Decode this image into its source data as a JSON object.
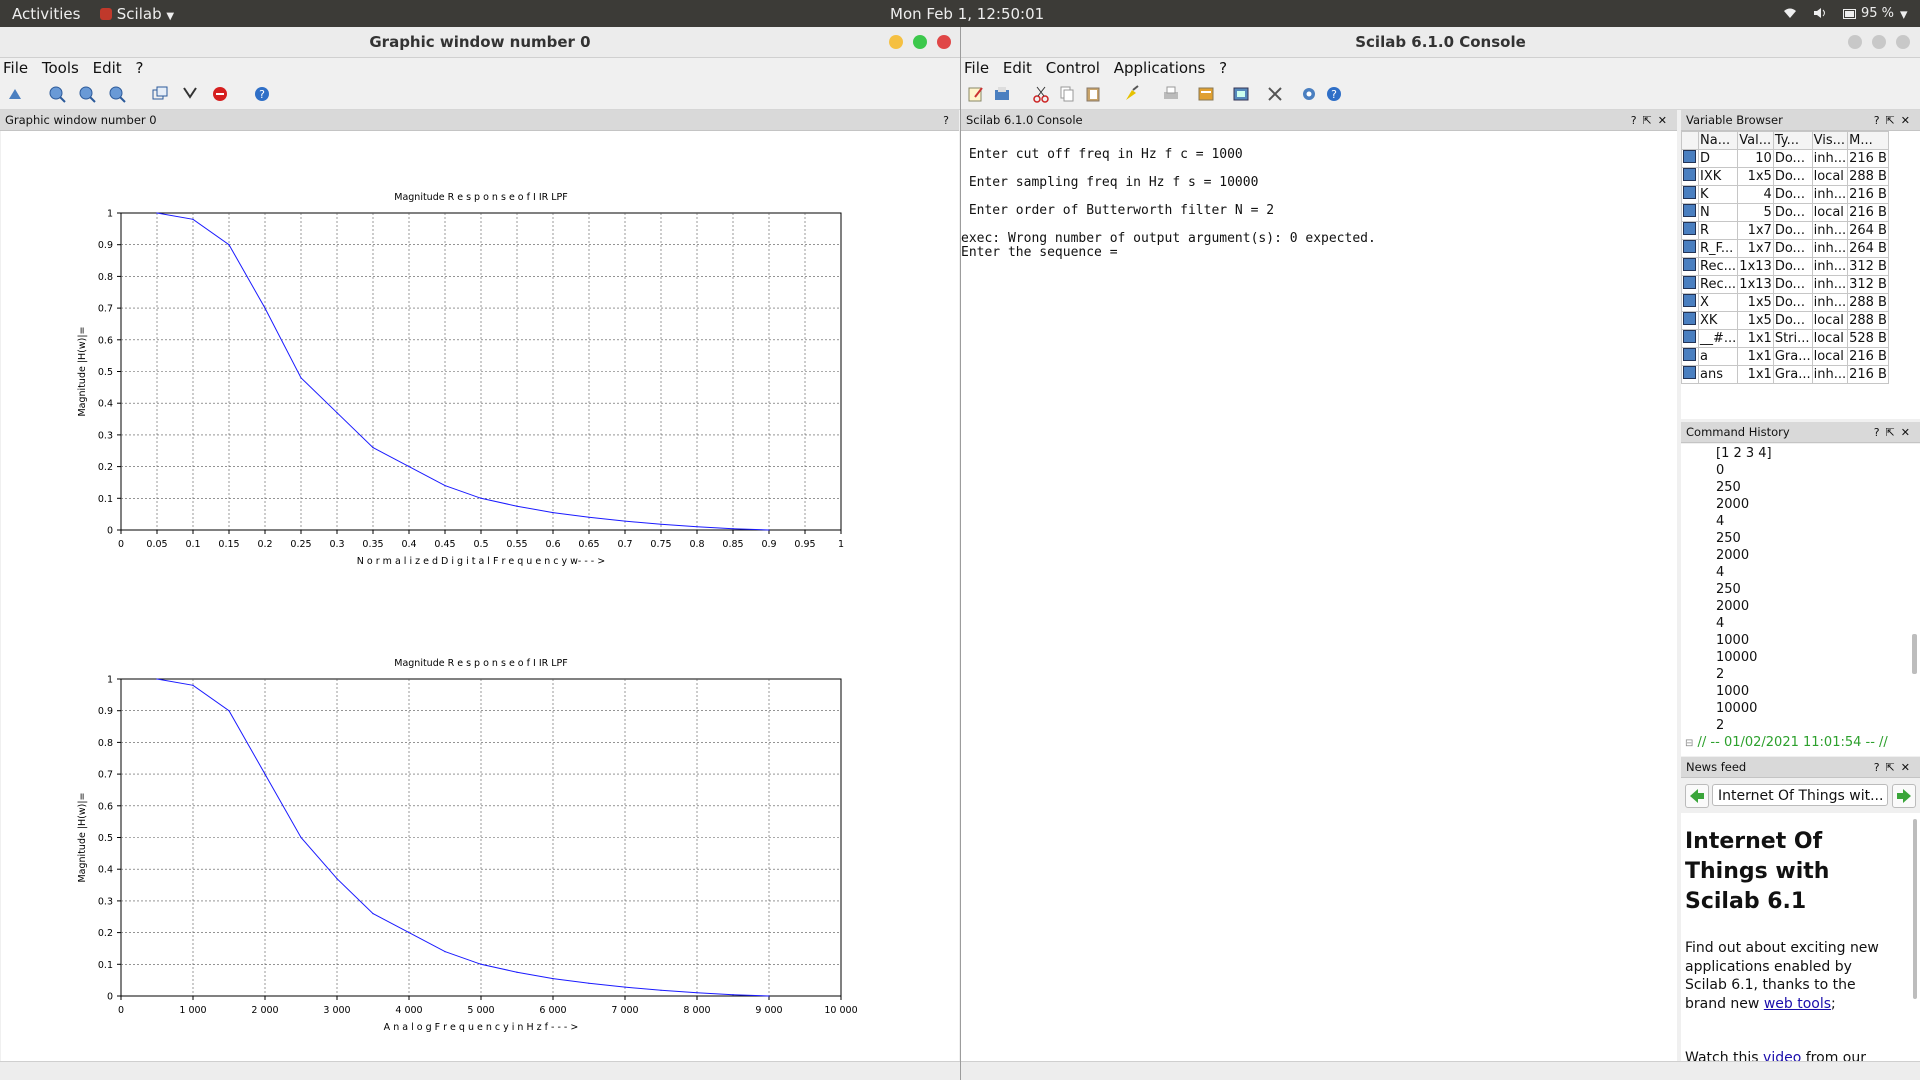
{
  "topbar": {
    "activities": "Activities",
    "app": "Scilab",
    "clock": "Mon Feb  1, 12:50:01",
    "battery": "95 %"
  },
  "graphic_window": {
    "title": "Graphic window number 0",
    "menu": [
      "File",
      "Tools",
      "Edit",
      "?"
    ],
    "dock_title": "Graphic window number 0"
  },
  "console_window": {
    "title": "Scilab 6.1.0 Console",
    "menu": [
      "File",
      "Edit",
      "Control",
      "Applications",
      "?"
    ],
    "dock_title": "Scilab 6.1.0 Console",
    "lines": [
      " Enter cut off freq in Hz f c = 1000",
      " Enter sampling freq in Hz f s = 10000",
      " Enter order of Butterworth filter N = 2",
      "exec: Wrong number of output argument(s): 0 expected.",
      "Enter the sequence ="
    ]
  },
  "variable_browser": {
    "title": "Variable Browser",
    "headers": [
      "Na...",
      "Val...",
      "Ty...",
      "Vis...",
      "M..."
    ],
    "rows": [
      [
        "D",
        "10",
        "Do...",
        "inh...",
        "216 B"
      ],
      [
        "IXK",
        "1x5",
        "Do...",
        "local",
        "288 B"
      ],
      [
        "K",
        "4",
        "Do...",
        "inh...",
        "216 B"
      ],
      [
        "N",
        "5",
        "Do...",
        "local",
        "216 B"
      ],
      [
        "R",
        "1x7",
        "Do...",
        "inh...",
        "264 B"
      ],
      [
        "R_F...",
        "1x7",
        "Do...",
        "inh...",
        "264 B"
      ],
      [
        "Rec...",
        "1x13",
        "Do...",
        "inh...",
        "312 B"
      ],
      [
        "Rec...",
        "1x13",
        "Do...",
        "inh...",
        "312 B"
      ],
      [
        "X",
        "1x5",
        "Do...",
        "inh...",
        "288 B"
      ],
      [
        "XK",
        "1x5",
        "Do...",
        "local",
        "288 B"
      ],
      [
        "__#...",
        "1x1",
        "Stri...",
        "local",
        "528 B"
      ],
      [
        "a",
        "1x1",
        "Gra...",
        "local",
        "216 B"
      ],
      [
        "ans",
        "1x1",
        "Gra...",
        "inh...",
        "216 B"
      ]
    ]
  },
  "command_history": {
    "title": "Command History",
    "items": [
      "[1 2 3 4]",
      "0",
      "250",
      "2000",
      "4",
      "250",
      "2000",
      "4",
      "250",
      "2000",
      "4",
      "1000",
      "10000",
      "2",
      "1000",
      "10000",
      "2"
    ],
    "session": "// -- 01/02/2021 11:01:54 -- //"
  },
  "news_feed": {
    "title": "News feed",
    "selected": "Internet Of Things wit...",
    "headline": "Internet Of Things with Scilab 6.1",
    "body": "Find out about exciting new applications enabled by Scilab 6.1, thanks to the brand new ",
    "link": "web tools",
    "body_end": ";",
    "watch_pre": "Watch this ",
    "watch_link": "video",
    "watch_post": " from our"
  },
  "chart_data": [
    {
      "type": "line",
      "title": "Magnitude R e s p o n s e o f I IR LPF",
      "xlabel": "N o r m a l i z e d D i g i t a l F r e q u e n c y w- - - >",
      "ylabel": "Magnitude |H(w)|=",
      "xlim": [
        0,
        1
      ],
      "ylim": [
        0,
        1
      ],
      "x_ticks": [
        "0",
        "0.05",
        "0.1",
        "0.15",
        "0.2",
        "0.25",
        "0.3",
        "0.35",
        "0.4",
        "0.45",
        "0.5",
        "0.55",
        "0.6",
        "0.65",
        "0.7",
        "0.75",
        "0.8",
        "0.85",
        "0.9",
        "0.95",
        "1"
      ],
      "y_ticks": [
        "0",
        "0.1",
        "0.2",
        "0.3",
        "0.4",
        "0.5",
        "0.6",
        "0.7",
        "0.8",
        "0.9",
        "1"
      ],
      "grid": true,
      "x": [
        0.05,
        0.1,
        0.15,
        0.2,
        0.25,
        0.3,
        0.35,
        0.4,
        0.45,
        0.5,
        0.55,
        0.6,
        0.65,
        0.7,
        0.75,
        0.8,
        0.85,
        0.9
      ],
      "y": [
        1.0,
        0.98,
        0.9,
        0.7,
        0.48,
        0.37,
        0.26,
        0.2,
        0.14,
        0.1,
        0.075,
        0.055,
        0.04,
        0.028,
        0.018,
        0.01,
        0.004,
        0.0
      ]
    },
    {
      "type": "line",
      "title": "Magnitude R e s p o n s e o f I IR LPF",
      "xlabel": "A n a l o g F r e q u e n c y i n H z f - - - >",
      "ylabel": "Magnitude |H(w)|=",
      "xlim": [
        0,
        10000
      ],
      "ylim": [
        0,
        1
      ],
      "x_ticks": [
        "0",
        "1 000",
        "2 000",
        "3 000",
        "4 000",
        "5 000",
        "6 000",
        "7 000",
        "8 000",
        "9 000",
        "10 000"
      ],
      "y_ticks": [
        "0",
        "0.1",
        "0.2",
        "0.3",
        "0.4",
        "0.5",
        "0.6",
        "0.7",
        "0.8",
        "0.9",
        "1"
      ],
      "grid": true,
      "x": [
        500,
        1000,
        1500,
        2000,
        2500,
        3000,
        3500,
        4000,
        4500,
        5000,
        5500,
        6000,
        6500,
        7000,
        7500,
        8000,
        8500,
        9000
      ],
      "y": [
        1.0,
        0.98,
        0.9,
        0.7,
        0.5,
        0.37,
        0.26,
        0.2,
        0.14,
        0.1,
        0.075,
        0.055,
        0.04,
        0.028,
        0.018,
        0.01,
        0.004,
        0.0
      ]
    }
  ],
  "colors": {
    "curve": "#1a1aff",
    "topbar": "#3c3b37",
    "history_session": "#2ca02c",
    "link": "#1a0dab"
  }
}
